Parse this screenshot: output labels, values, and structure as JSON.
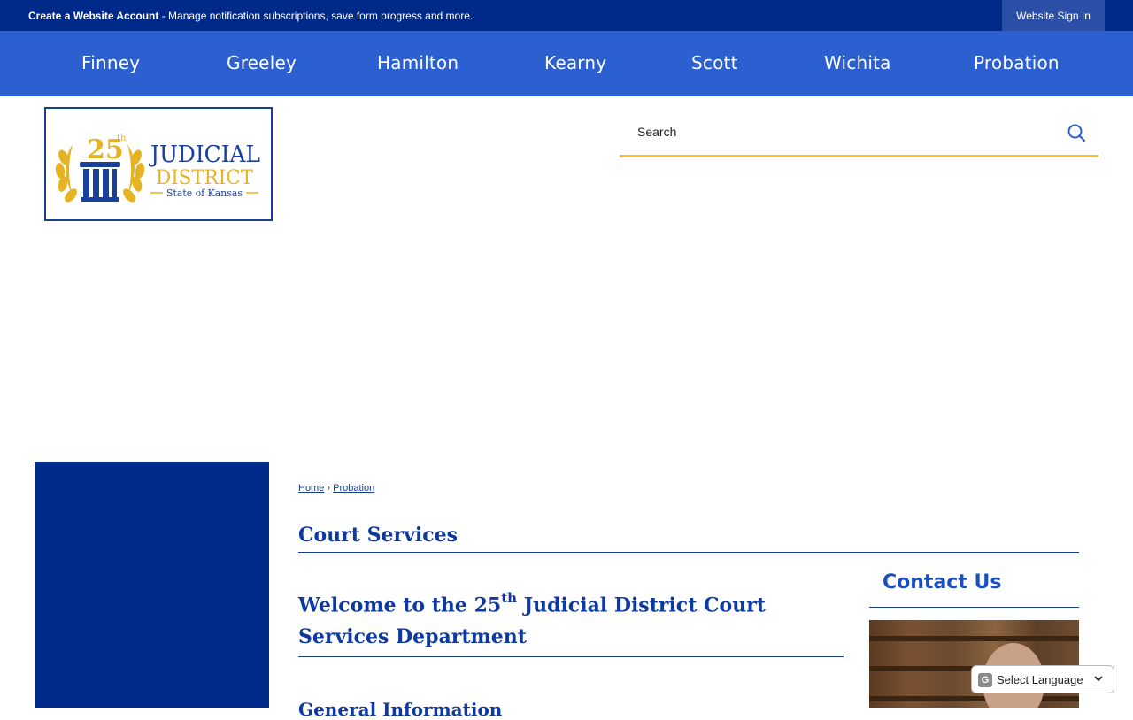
{
  "topbar": {
    "create_account_label": "Create a Website Account",
    "create_account_desc": " - Manage notification subscriptions, save form progress and more.",
    "sign_in_label": "Website Sign In"
  },
  "nav": {
    "items": [
      {
        "label": "Finney"
      },
      {
        "label": "Greeley"
      },
      {
        "label": "Hamilton"
      },
      {
        "label": "Kearny"
      },
      {
        "label": "Scott"
      },
      {
        "label": "Wichita"
      },
      {
        "label": "Probation"
      }
    ]
  },
  "logo": {
    "number": "25",
    "ordinal": "th",
    "line1": "JUDICIAL",
    "line2": "DISTRICT",
    "line3": "State of Kansas"
  },
  "search": {
    "placeholder": "Search"
  },
  "breadcrumb": {
    "home": "Home",
    "separator": "›",
    "current": "Probation"
  },
  "page": {
    "title": "Court Services",
    "welcome_pre": "Welcome to the 25",
    "welcome_sup": "th",
    "welcome_post": " Judicial District Court Services Department",
    "partial_heading": "General Information"
  },
  "contact": {
    "heading": "Contact Us"
  },
  "translate": {
    "label": "Select Language"
  },
  "colors": {
    "topbar": "#002a8a",
    "nav": "#2c5fd0",
    "accent_yellow": "#f1c232",
    "heading_blue": "#0e3aa0"
  }
}
